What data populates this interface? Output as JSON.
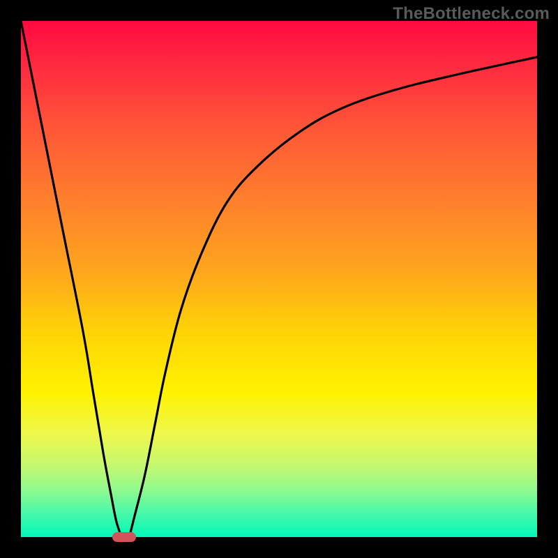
{
  "watermark": "TheBottleneck.com",
  "chart_data": {
    "type": "line",
    "title": "",
    "xlabel": "",
    "ylabel": "",
    "xlim": [
      0,
      100
    ],
    "ylim": [
      0,
      100
    ],
    "grid": false,
    "legend": false,
    "series": [
      {
        "name": "left-branch",
        "x": [
          0,
          4,
          8,
          12,
          14,
          16,
          17.5,
          18.5,
          19.5
        ],
        "y": [
          100,
          80,
          60,
          40,
          28,
          16,
          8,
          3,
          0
        ]
      },
      {
        "name": "right-branch",
        "x": [
          21,
          22,
          24,
          26,
          28,
          31,
          35,
          40,
          46,
          54,
          62,
          72,
          84,
          100
        ],
        "y": [
          0,
          4,
          12,
          22,
          32,
          44,
          55,
          65,
          72,
          78.5,
          83,
          86.5,
          89.5,
          93
        ]
      }
    ],
    "marker": {
      "x": 20,
      "y": 0,
      "shape": "pill",
      "color": "#d2545b"
    },
    "background_gradient": {
      "direction": "top-to-bottom",
      "stops": [
        {
          "pos": 0,
          "color": "#ff0a40"
        },
        {
          "pos": 50,
          "color": "#ffa41e"
        },
        {
          "pos": 72,
          "color": "#fff200"
        },
        {
          "pos": 100,
          "color": "#00f7b8"
        }
      ]
    }
  }
}
